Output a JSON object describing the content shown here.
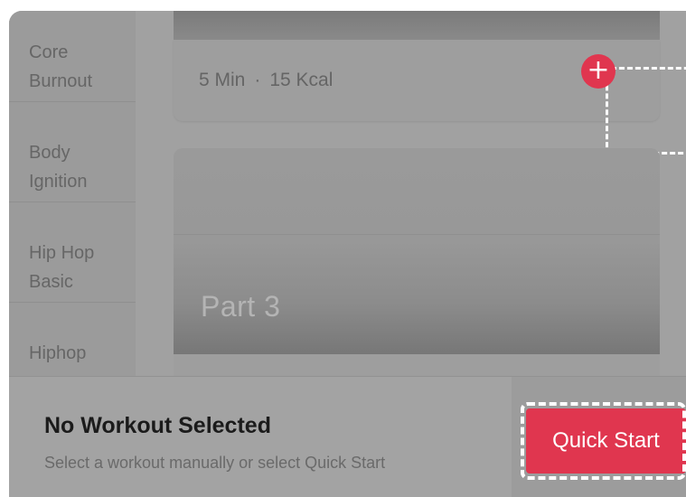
{
  "sidebar": {
    "items": [
      {
        "line1": "Core",
        "line2": "Burnout"
      },
      {
        "line1": "Body",
        "line2": "Ignition"
      },
      {
        "line1": "Hip Hop",
        "line2": "Basic"
      },
      {
        "line1": "Hiphop",
        "line2": ""
      }
    ]
  },
  "workout_card": {
    "duration": "5 Min",
    "separator": "·",
    "calories": "15 Kcal",
    "add_symbol": "+"
  },
  "part_card": {
    "title": "Part 3"
  },
  "bottom_bar": {
    "title": "No Workout Selected",
    "subtitle": "Select a workout manually or select Quick Start",
    "quick_start_label": "Quick Start"
  },
  "colors": {
    "accent": "#e0364f",
    "overlay": "#a3a3a3"
  },
  "icons": {
    "add": "plus-icon"
  }
}
